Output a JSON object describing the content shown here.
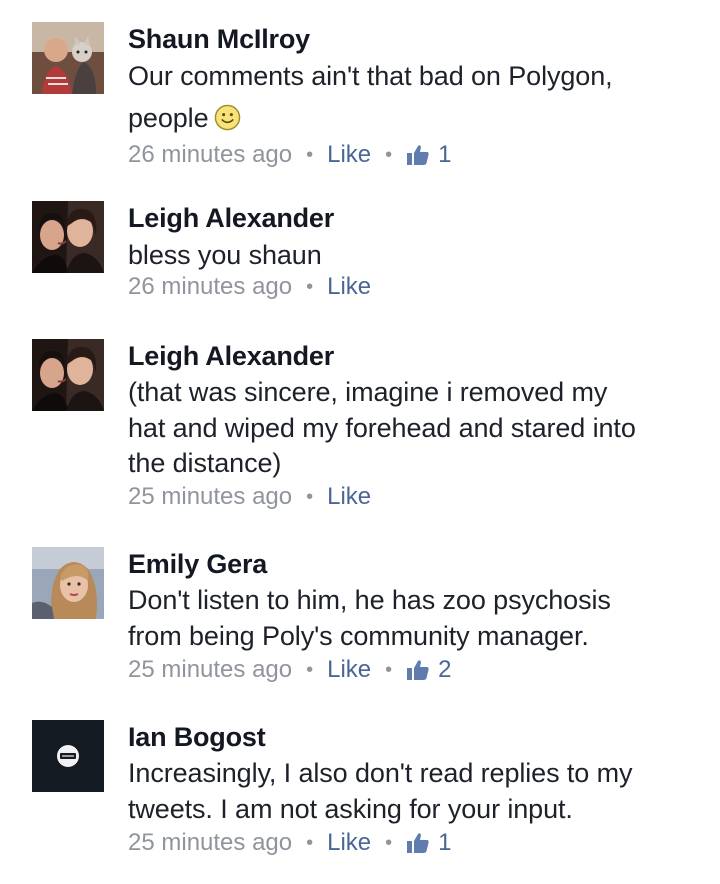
{
  "comments": [
    {
      "author": "Shaun McIlroy",
      "text": "Our comments ain't that bad on Polygon, people",
      "text_main": "Our comments ain't that bad on Polygon,",
      "text_line2": "people",
      "emoji": "smiley-emoji",
      "time": "26 minutes ago",
      "like_label": "Like",
      "like_count": "1",
      "avatar": "avatar-photo-man-with-dog"
    },
    {
      "author": "Leigh Alexander",
      "text": "bless you shaun",
      "time": "26 minutes ago",
      "like_label": "Like",
      "avatar": "avatar-photo-two-women"
    },
    {
      "author": "Leigh Alexander",
      "text": "(that was sincere, imagine i removed my hat and wiped my forehead and stared into the distance)",
      "time": "25 minutes ago",
      "like_label": "Like",
      "avatar": "avatar-photo-two-women"
    },
    {
      "author": "Emily Gera",
      "text": "Don't listen to him, he has zoo psychosis from being Poly's community manager.",
      "time": "25 minutes ago",
      "like_label": "Like",
      "like_count": "2",
      "avatar": "avatar-photo-woman-selfie"
    },
    {
      "author": "Ian Bogost",
      "text": "Increasingly, I also don't read replies to my tweets. I am not asking for your input.",
      "time": "25 minutes ago",
      "like_label": "Like",
      "like_count": "1",
      "avatar": "avatar-no-entry-logo"
    }
  ],
  "meta": {
    "separator": "•"
  },
  "colors": {
    "link": "#4b6696",
    "meta": "#90949c",
    "name": "#141823"
  }
}
